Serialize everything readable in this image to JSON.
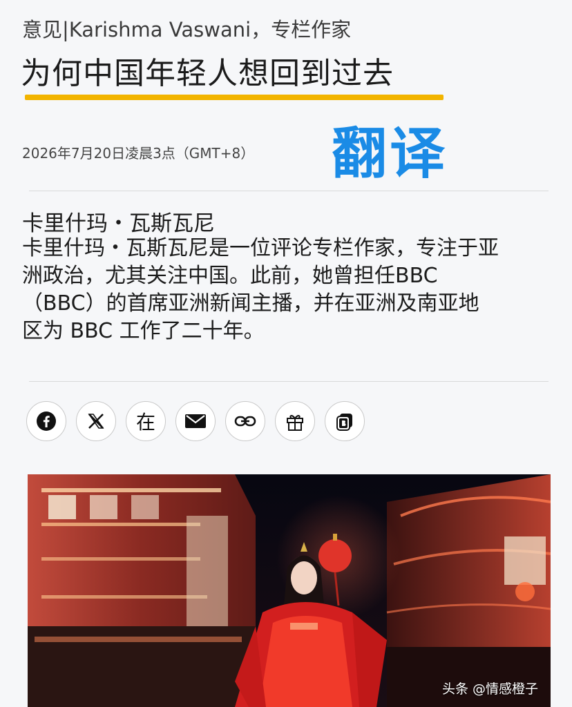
{
  "article": {
    "byline": "意见|Karishma Vaswani，专栏作家",
    "headline": "为何中国年轻人想回到过去",
    "timestamp": "2026年7月20日凌晨3点（GMT+8）",
    "translate_tag": "翻译"
  },
  "author": {
    "name": "卡里什玛・瓦斯瓦尼",
    "bio": "卡里什玛・瓦斯瓦尼是一位评论专栏作家，专注于亚洲政治，尤其关注中国。此前，她曾担任BBC（BBC）的首席亚洲新闻主播，并在亚洲及南亚地区为 BBC 工作了二十年。"
  },
  "share": {
    "buttons": [
      {
        "icon": "facebook-icon"
      },
      {
        "icon": "x-icon"
      },
      {
        "icon": "zai-icon",
        "label": "在"
      },
      {
        "icon": "email-icon"
      },
      {
        "icon": "link-icon"
      },
      {
        "icon": "gift-icon"
      },
      {
        "icon": "bookmark-icon"
      }
    ]
  },
  "watermark": "头条 @情感橙子",
  "colors": {
    "underline": "#f2b400",
    "translate_tag": "#1a8be6",
    "background": "#f6f7f9"
  }
}
